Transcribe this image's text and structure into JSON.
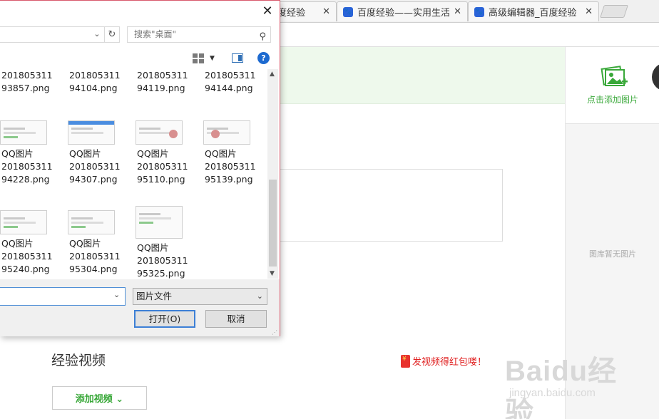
{
  "browser": {
    "tabs": [
      {
        "title": "度经验"
      },
      {
        "title": "百度经验——实用生活指南"
      },
      {
        "title": "高级编辑器_百度经验"
      }
    ],
    "close_glyph": "✕"
  },
  "page": {
    "add_image_label": "点击添加图片",
    "no_image_text": "图库暂无图片",
    "video_heading": "经验视频",
    "red_packet_text": "发视频得红包喽！",
    "add_video_label": "添加视频 ⌄",
    "watermark_main": "Baidu经验",
    "watermark_sub": "jingyan.baidu.com"
  },
  "dialog": {
    "close_glyph": "✕",
    "search_placeholder": "搜索\"桌面\"",
    "files": [
      {
        "line1": "201805311",
        "line2": "93857.png"
      },
      {
        "line1": "201805311",
        "line2": "94104.png"
      },
      {
        "line1": "201805311",
        "line2": "94119.png"
      },
      {
        "line1": "201805311",
        "line2": "94144.png"
      },
      {
        "name": "QQ图片",
        "line1": "201805311",
        "line2": "94228.png"
      },
      {
        "name": "QQ图片",
        "line1": "201805311",
        "line2": "94307.png"
      },
      {
        "name": "QQ图片",
        "line1": "201805311",
        "line2": "95110.png"
      },
      {
        "name": "QQ图片",
        "line1": "201805311",
        "line2": "95139.png"
      },
      {
        "name": "QQ图片",
        "line1": "201805311",
        "line2": "95240.png"
      },
      {
        "name": "QQ图片",
        "line1": "201805311",
        "line2": "95304.png"
      },
      {
        "name": "QQ图片",
        "line1": "201805311",
        "line2": "95325.png"
      }
    ],
    "file_name_value": "",
    "file_type_value": "图片文件",
    "open_button": "打开(O)",
    "cancel_button": "取消"
  }
}
